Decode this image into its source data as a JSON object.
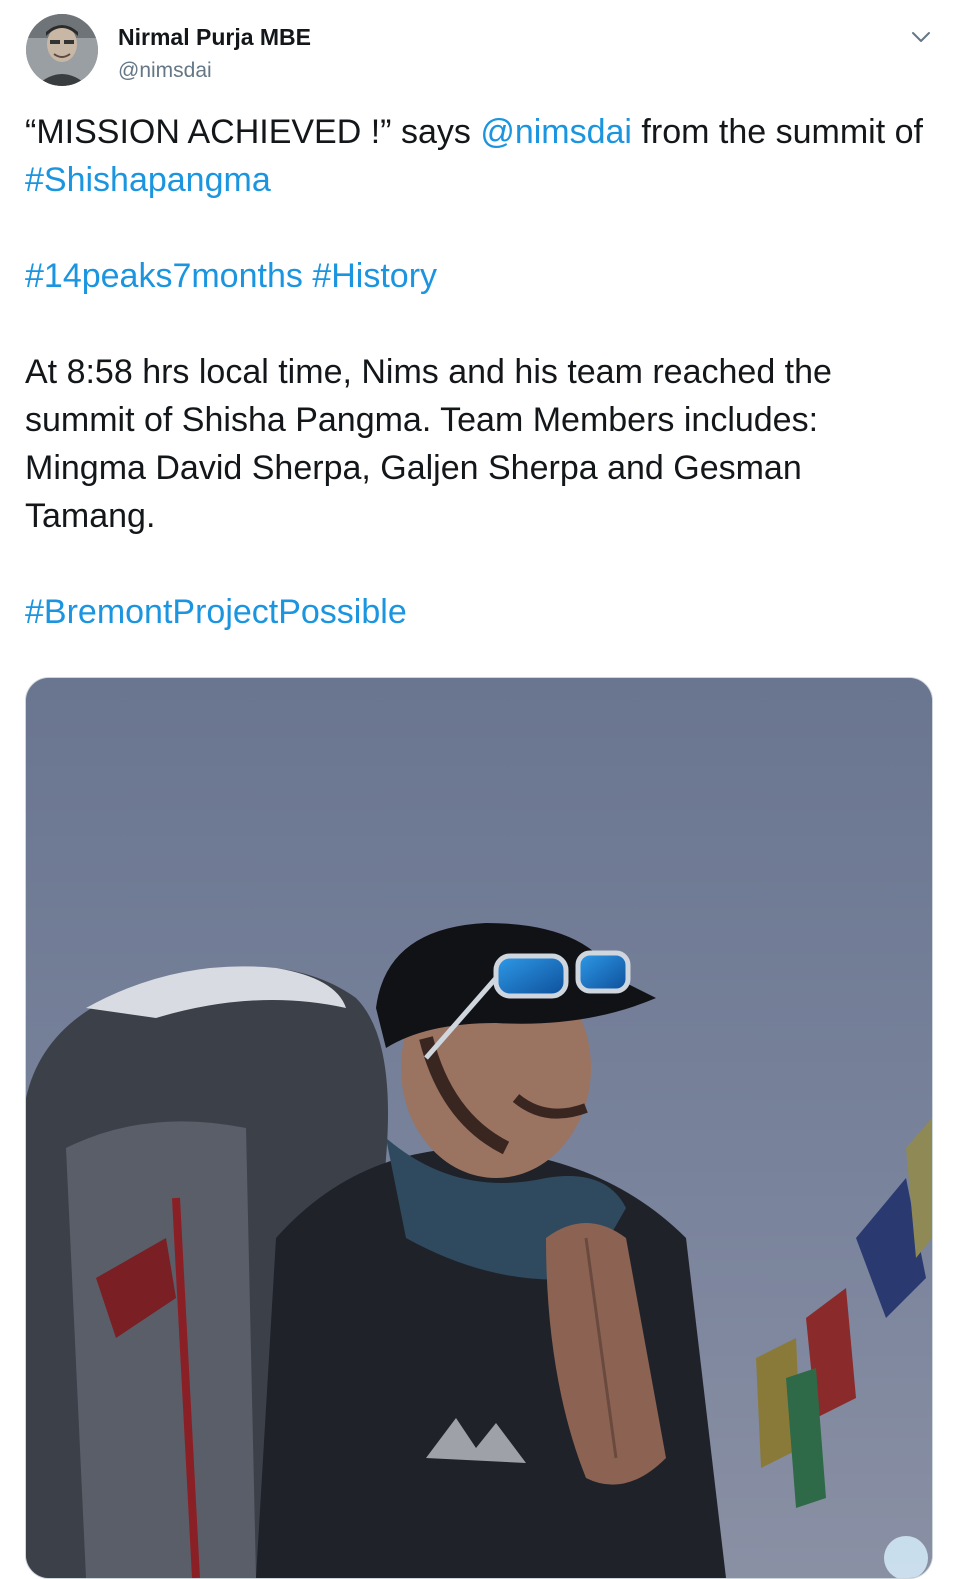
{
  "author": {
    "display_name": "Nirmal Purja MBE",
    "handle": "@nimsdai"
  },
  "menu_icon": "chevron-down-icon",
  "tweet": {
    "line1_a": "“MISSION ACHIEVED !” says ",
    "mention": "@nimsdai",
    "line1_b": " from the summit of ",
    "hashtag_shishapangma": "#Shishapangma",
    "hashtag_14peaks": "#14peaks7months",
    "hashtag_history": "#History",
    "body": "At 8:58 hrs local time, Nims and his team reached the summit of Shisha Pangma. Team Members includes: Mingma David Sherpa, Galjen Sherpa and Gesman Tamang.",
    "hashtag_bremont": "#BremontProjectPossible"
  },
  "colors": {
    "link": "#1b95e0",
    "text": "#14171a",
    "secondary": "#657786",
    "border": "#ccd6dd"
  }
}
